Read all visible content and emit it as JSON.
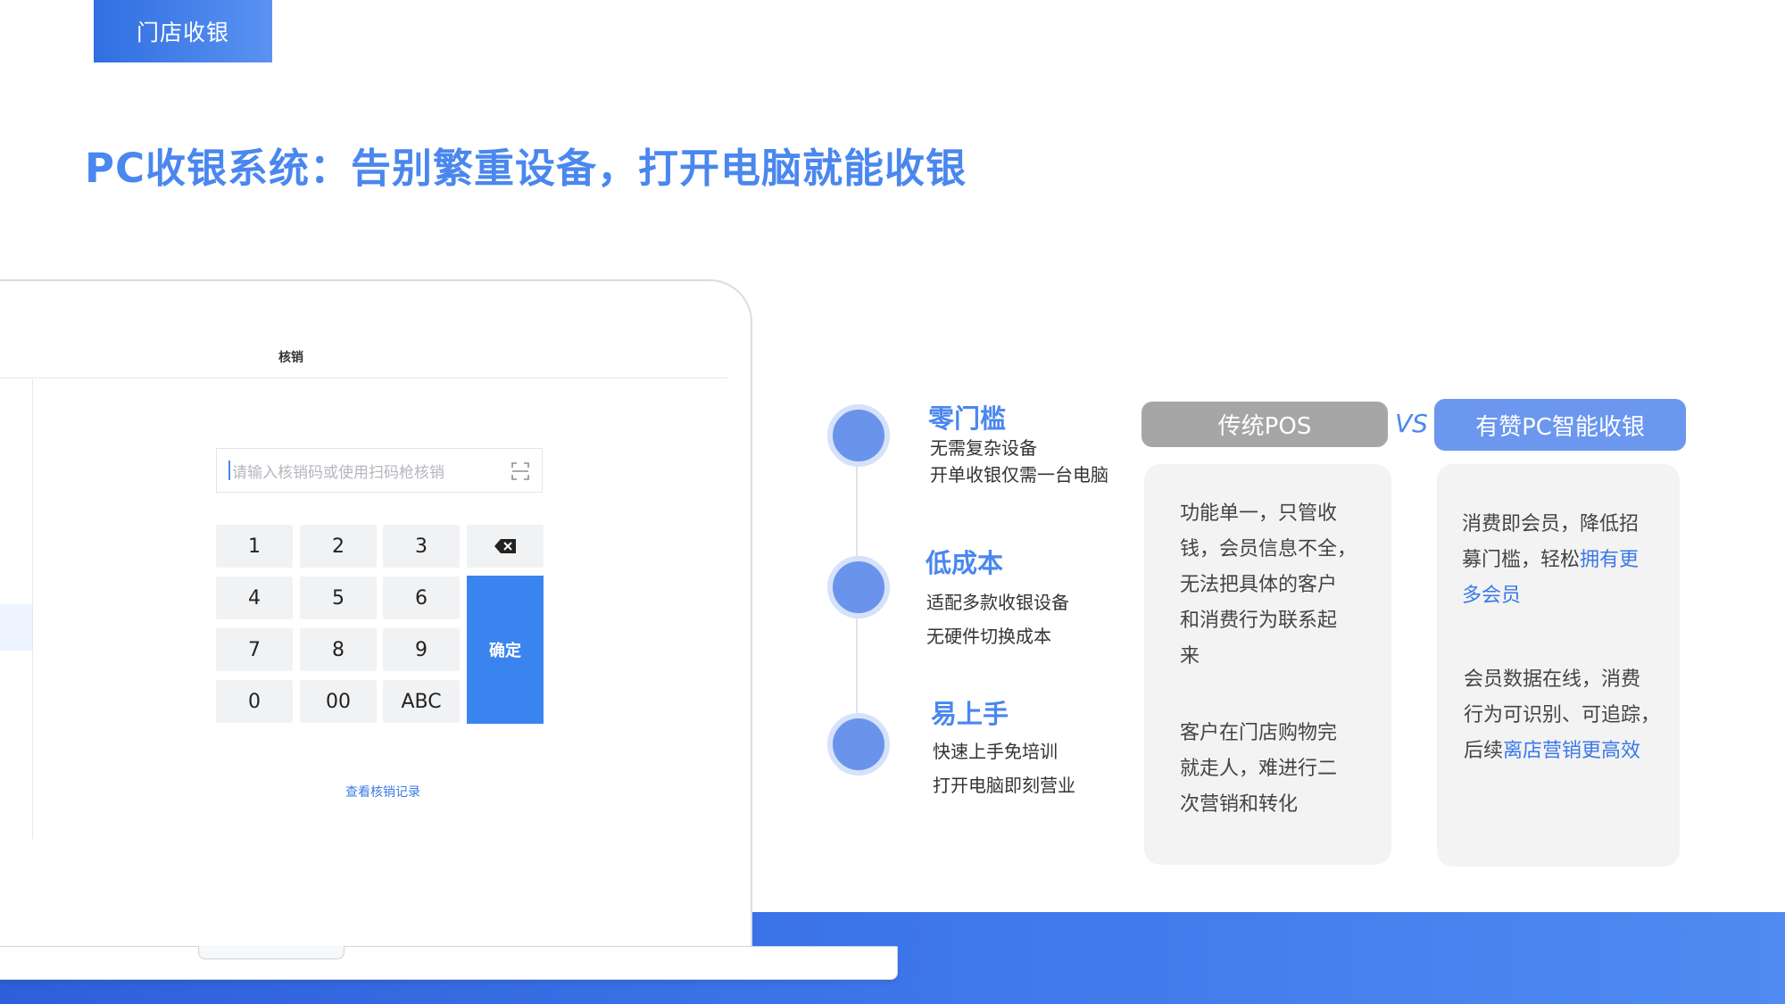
{
  "header": {
    "tag": "门店收银",
    "title": "PC收银系统：告别繁重设备，打开电脑就能收银"
  },
  "screen": {
    "title": "核销",
    "input_placeholder": "请输入核销码或使用扫码枪核销",
    "keys": [
      "1",
      "2",
      "3",
      "4",
      "5",
      "6",
      "7",
      "8",
      "9",
      "0",
      "00",
      "ABC"
    ],
    "confirm_label": "确定",
    "view_records_link": "查看核销记录"
  },
  "features": [
    {
      "title": "零门槛",
      "lines": [
        "无需复杂设备",
        "开单收银仅需一台电脑"
      ]
    },
    {
      "title": "低成本",
      "lines": [
        "适配多款收银设备",
        "无硬件切换成本"
      ]
    },
    {
      "title": "易上手",
      "lines": [
        "快速上手免培训",
        "打开电脑即刻营业"
      ]
    }
  ],
  "comparison": {
    "left_label": "传统POS",
    "vs": "VS",
    "right_label": "有赞PC智能收银",
    "left_para1_lines": [
      "功能单一，只管收",
      "钱，会员信息不全，",
      "无法把具体的客户",
      "和消费行为联系起",
      "来"
    ],
    "left_para2_lines": [
      "客户在门店购物完",
      "就走人，难进行二",
      "次营销和转化"
    ],
    "right_para1_line1": "消费即会员，降低招",
    "right_para1_line2_plain": "募门槛，轻松",
    "right_para1_line2_hl": "拥有更",
    "right_para1_line3_hl": "多会员",
    "right_para2_line1": "会员数据在线，消费",
    "right_para2_line2": "行为可识别、可追踪，",
    "right_para2_line3_plain": "后续",
    "right_para2_line3_hl": "离店营销更高效"
  },
  "colors": {
    "accent": "#4a87ee",
    "confirm": "#3a84f0",
    "pos_pill": "#a6a6a6",
    "pc_pill": "#6b97ee"
  }
}
